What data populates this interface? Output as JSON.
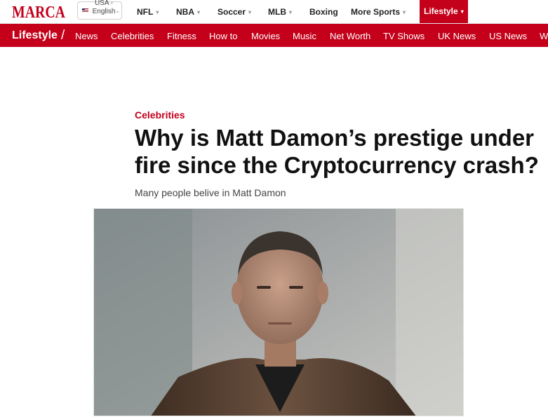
{
  "brand": {
    "name": "MARCA",
    "accent": "#c4001a"
  },
  "language": {
    "label": "USA - English"
  },
  "topnav": {
    "nfl": "NFL",
    "nba": "NBA",
    "soccer": "Soccer",
    "mlb": "MLB",
    "boxing": "Boxing",
    "more_sports": "More Sports",
    "lifestyle": "Lifestyle"
  },
  "subnav": {
    "section": "Lifestyle",
    "items": [
      "News",
      "Celebrities",
      "Fitness",
      "How to",
      "Movies",
      "Music",
      "Net Worth",
      "TV Shows",
      "UK News",
      "US News",
      "W"
    ]
  },
  "article": {
    "category": "Celebrities",
    "headline": "Why is Matt Damon’s prestige under fire since the Cryptocurrency crash?",
    "subtitle": "Many people belive in Matt Damon"
  }
}
